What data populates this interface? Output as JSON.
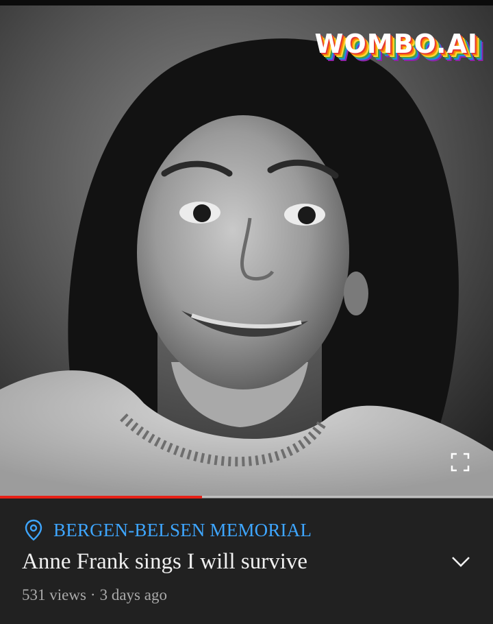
{
  "video": {
    "watermark": "WOMBO.AI",
    "progress_fraction": 0.41,
    "progress_color": "#e62117",
    "fullscreen_icon": "fullscreen-icon"
  },
  "details": {
    "location_icon": "location-pin-icon",
    "location": "BERGEN-BELSEN MEMORIAL",
    "location_color": "#3ea6ff",
    "title": "Anne Frank sings I will survive",
    "views": "531 views",
    "separator": "·",
    "age": "3 days ago",
    "expand_icon": "chevron-down-icon"
  }
}
